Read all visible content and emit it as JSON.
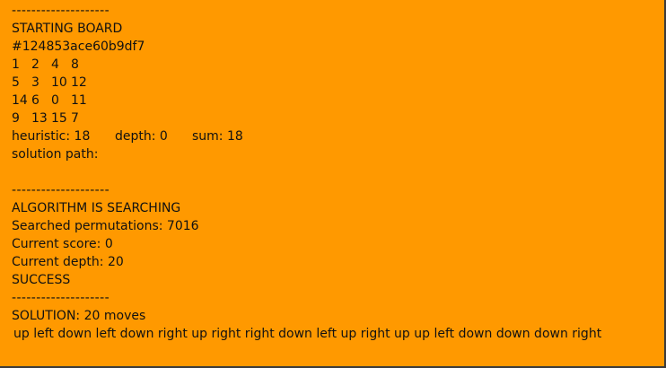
{
  "separator": "--------------------",
  "starting_board": {
    "title": "STARTING BOARD",
    "hash": "#124853ace60b9df7",
    "rows": [
      [
        "1",
        "2",
        "4",
        "8"
      ],
      [
        "5",
        "3",
        "10",
        "12"
      ],
      [
        "14",
        "6",
        "0",
        "11"
      ],
      [
        "9",
        "13",
        "15",
        "7"
      ]
    ],
    "heuristic": "heuristic: 18",
    "depth": "depth: 0",
    "sum": "sum: 18",
    "solution_path": "solution path:"
  },
  "search": {
    "title": "ALGORITHM IS SEARCHING",
    "permutations": "Searched permutations: 7016",
    "score": "Current score: 0",
    "depth": "Current depth: 20",
    "status": "SUCCESS"
  },
  "solution": {
    "summary": "SOLUTION: 20 moves",
    "moves": "up left down left down right up right right down left up right up up left down down down right"
  },
  "colors": {
    "background": "#ff9900",
    "text": "#111111"
  }
}
